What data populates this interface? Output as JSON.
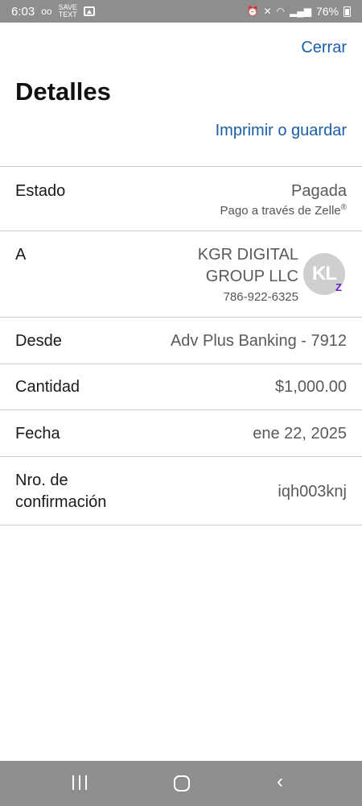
{
  "status_bar": {
    "time": "6:03",
    "voicemail_icon": "voicemail-icon",
    "tiny_label_top": "SAVE",
    "tiny_label_bottom": "TEXT",
    "battery_percent": "76%"
  },
  "header": {
    "close_label": "Cerrar",
    "title": "Detalles",
    "print_label": "Imprimir o guardar"
  },
  "details": {
    "status_label": "Estado",
    "status_value": "Pagada",
    "status_sub": "Pago a través de Zelle",
    "status_sub_mark": "®",
    "to_label": "A",
    "to_name_line1": "KGR DIGITAL",
    "to_name_line2": "GROUP LLC",
    "to_phone": "786-922-6325",
    "avatar_initials": "KL",
    "avatar_badge": "Z",
    "from_label": "Desde",
    "from_value": "Adv Plus Banking - 7912",
    "amount_label": "Cantidad",
    "amount_value": "$1,000.00",
    "date_label": "Fecha",
    "date_value": "ene 22, 2025",
    "confirmation_label_line1": "Nro. de",
    "confirmation_label_line2": "confirmación",
    "confirmation_value": "iqh003knj"
  },
  "colors": {
    "link": "#1a5fa6",
    "zelle": "#6d1ed4",
    "system_bar": "#8e8e8e"
  }
}
